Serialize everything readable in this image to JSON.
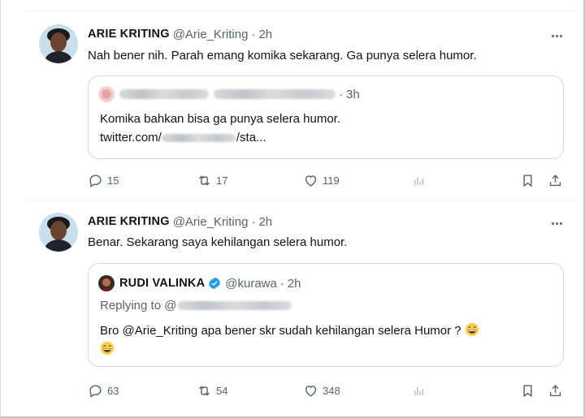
{
  "tweets": [
    {
      "author": "ARIE KRITING",
      "handle": "@Arie_Kriting",
      "dot": "·",
      "time": "2h",
      "text": "Nah bener nih. Parah emang komika sekarang. Ga punya selera humor.",
      "quote": {
        "time": "3h",
        "line1": "Komika bahkan bisa ga punya selera humor.",
        "link_prefix": "twitter.com/",
        "link_suffix": "/sta..."
      },
      "stats": {
        "replies": "15",
        "retweets": "17",
        "likes": "119"
      }
    },
    {
      "author": "ARIE KRITING",
      "handle": "@Arie_Kriting",
      "dot": "·",
      "time": "2h",
      "text": "Benar. Sekarang saya kehilangan selera humor.",
      "quote": {
        "author": "RUDI VALINKA",
        "handle": "@kurawa",
        "time": "2h",
        "replying_to": "Replying to @",
        "line1": "Bro @Arie_Kriting apa bener skr sudah kehilangan selera Humor ?"
      },
      "stats": {
        "replies": "63",
        "retweets": "54",
        "likes": "348"
      }
    }
  ],
  "colors": {
    "text": "#0f1419",
    "secondary": "#536471",
    "border": "#cfd9de",
    "verified": "#1d9bf0"
  },
  "icons": [
    "more-icon",
    "reply-icon",
    "retweet-icon",
    "like-icon",
    "views-icon",
    "bookmark-icon",
    "share-icon",
    "verified-badge-icon",
    "grinning-emoji-icon"
  ]
}
